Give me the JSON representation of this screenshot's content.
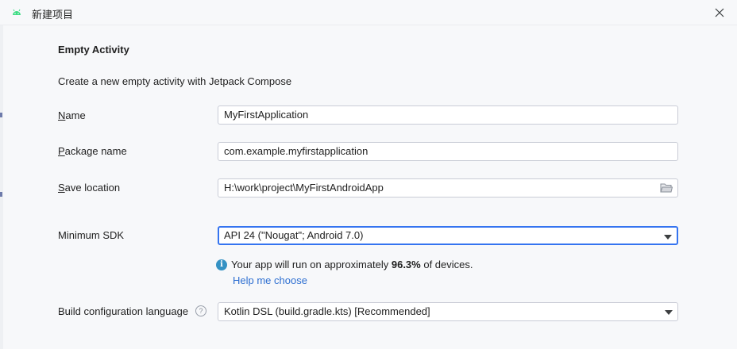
{
  "window": {
    "title": "新建项目",
    "close_glyph": "✕"
  },
  "form": {
    "heading": "Empty Activity",
    "description": "Create a new empty activity with Jetpack Compose",
    "name": {
      "label_first": "N",
      "label_rest": "ame",
      "value": "MyFirstApplication"
    },
    "package": {
      "label_first": "P",
      "label_rest": "ackage name",
      "value": "com.example.myfirstapplication"
    },
    "save_location": {
      "label_first": "S",
      "label_rest": "ave location",
      "value": "H:\\work\\project\\MyFirstAndroidApp"
    },
    "min_sdk": {
      "label": "Minimum SDK",
      "value": "API 24 (\"Nougat\"; Android 7.0)"
    },
    "info": {
      "icon_glyph": "i",
      "prefix": "Your app will run on approximately ",
      "percent": "96.3%",
      "suffix": " of devices."
    },
    "help_link": "Help me choose",
    "build_language": {
      "label": "Build configuration language",
      "help_glyph": "?",
      "value": "Kotlin DSL (build.gradle.kts) [Recommended]"
    }
  },
  "colors": {
    "accent": "#3574f0",
    "link": "#2e6fd1",
    "info_icon": "#3592c4",
    "android_green": "#3ddc84"
  }
}
